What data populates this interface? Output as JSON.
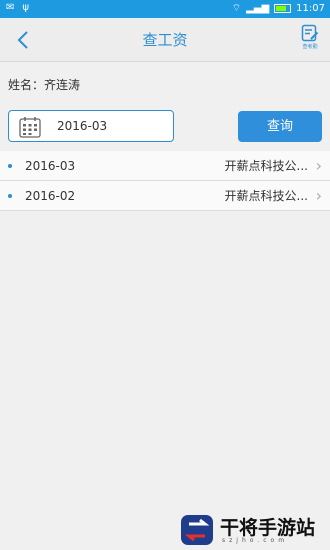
{
  "status_bar": {
    "time": "11:07"
  },
  "header": {
    "title": "查工资",
    "attendance_label": "查考勤"
  },
  "profile": {
    "name_label": "姓名：齐连涛"
  },
  "search": {
    "date_value": "2016-03",
    "query_label": "查询"
  },
  "records": [
    {
      "date": "2016-03",
      "company": "开薪点科技公..."
    },
    {
      "date": "2016-02",
      "company": "开薪点科技公..."
    }
  ],
  "watermark": {
    "title": "干将手游站",
    "subtitle": "szjho.com"
  },
  "colors": {
    "status_bar": "#1e9be0",
    "accent": "#2e8ecf",
    "button": "#2f8fda"
  }
}
